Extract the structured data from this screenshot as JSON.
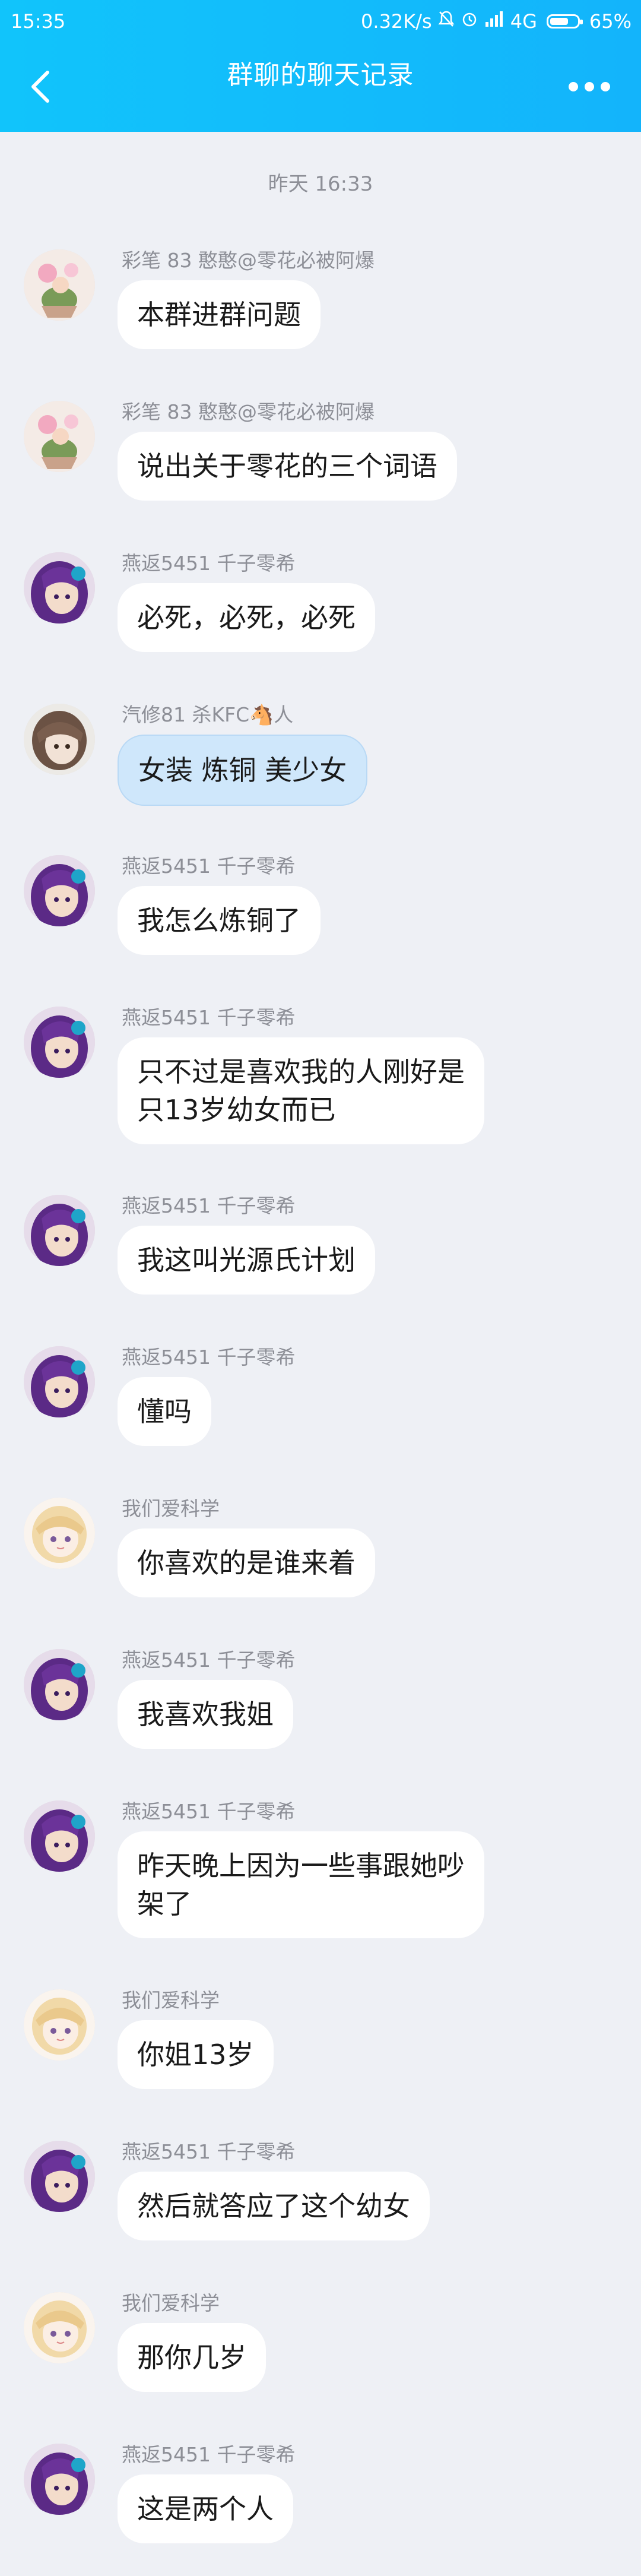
{
  "status_bar": {
    "time": "15:35",
    "speed": "0.32K/s",
    "network": "4G",
    "battery": "65%"
  },
  "nav": {
    "title": "群聊的聊天记录"
  },
  "timestamp": "昨天 16:33",
  "messages": [
    {
      "sender": "彩笔 83 憨憨@零花必被阿爆",
      "lines": [
        "本群进群问题"
      ],
      "avatar": "flowers"
    },
    {
      "sender": "彩笔 83 憨憨@零花必被阿爆",
      "lines": [
        "说出关于零花的三个词语"
      ],
      "avatar": "flowers"
    },
    {
      "sender": "燕返5451 千子零希",
      "lines": [
        "必死，必死，必死"
      ],
      "avatar": "purple"
    },
    {
      "sender": "汽修81 杀KFC🐴人",
      "lines": [
        "女装 炼铜 美少女"
      ],
      "avatar": "brown",
      "bubble_style": "blue"
    },
    {
      "sender": "燕返5451 千子零希",
      "lines": [
        "我怎么炼铜了"
      ],
      "avatar": "purple"
    },
    {
      "sender": "燕返5451 千子零希",
      "lines": [
        "只不过是喜欢我的人刚好是",
        "只13岁幼女而已"
      ],
      "avatar": "purple"
    },
    {
      "sender": "燕返5451 千子零希",
      "lines": [
        "我这叫光源氏计划"
      ],
      "avatar": "purple"
    },
    {
      "sender": "燕返5451 千子零希",
      "lines": [
        "懂吗"
      ],
      "avatar": "purple"
    },
    {
      "sender": "我们爱科学",
      "lines": [
        "你喜欢的是谁来着"
      ],
      "avatar": "blonde"
    },
    {
      "sender": "燕返5451 千子零希",
      "lines": [
        "我喜欢我姐"
      ],
      "avatar": "purple"
    },
    {
      "sender": "燕返5451 千子零希",
      "lines": [
        "昨天晚上因为一些事跟她吵",
        "架了"
      ],
      "avatar": "purple"
    },
    {
      "sender": "我们爱科学",
      "lines": [
        "你姐13岁"
      ],
      "avatar": "blonde"
    },
    {
      "sender": "燕返5451 千子零希",
      "lines": [
        "然后就答应了这个幼女"
      ],
      "avatar": "purple"
    },
    {
      "sender": "我们爱科学",
      "lines": [
        "那你几岁"
      ],
      "avatar": "blonde"
    },
    {
      "sender": "燕返5451 千子零希",
      "lines": [
        "这是两个人"
      ],
      "avatar": "purple"
    }
  ]
}
